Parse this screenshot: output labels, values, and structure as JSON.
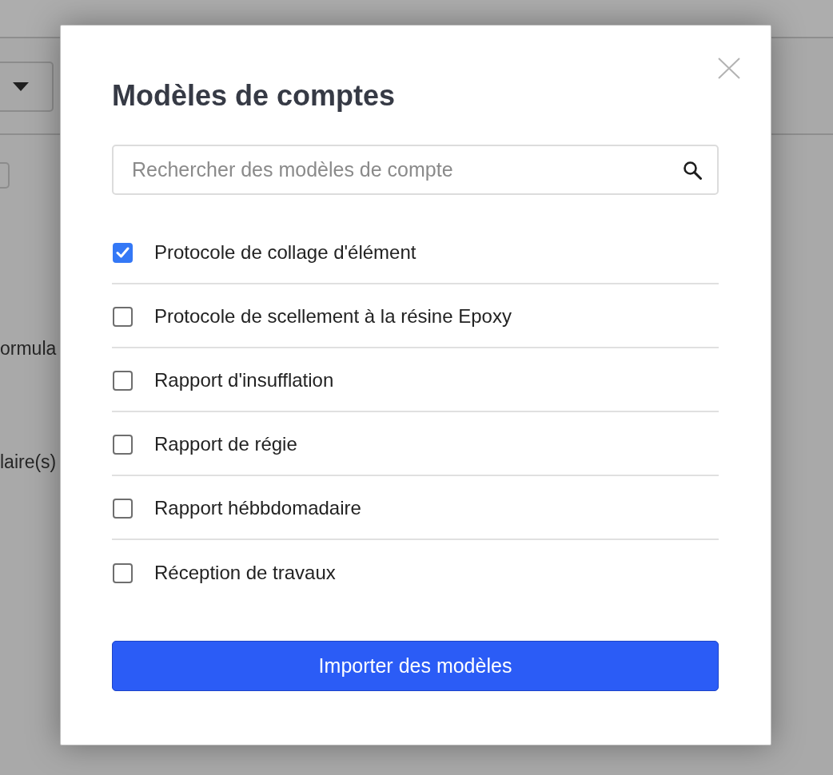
{
  "background_page": {
    "labels": [
      "ormula",
      "laire(s)"
    ]
  },
  "dialog": {
    "title": "Modèles de comptes",
    "search": {
      "placeholder": "Rechercher des modèles de compte"
    },
    "templates": [
      {
        "label": "Protocole de collage d'élément",
        "checked": true
      },
      {
        "label": "Protocole de scellement à la résine Epoxy",
        "checked": false
      },
      {
        "label": "Rapport d'insufflation",
        "checked": false
      },
      {
        "label": "Rapport de régie",
        "checked": false
      },
      {
        "label": "Rapport hébbdomadaire",
        "checked": false
      },
      {
        "label": "Réception de travaux",
        "checked": false
      }
    ],
    "import_button": "Importer des modèles"
  }
}
